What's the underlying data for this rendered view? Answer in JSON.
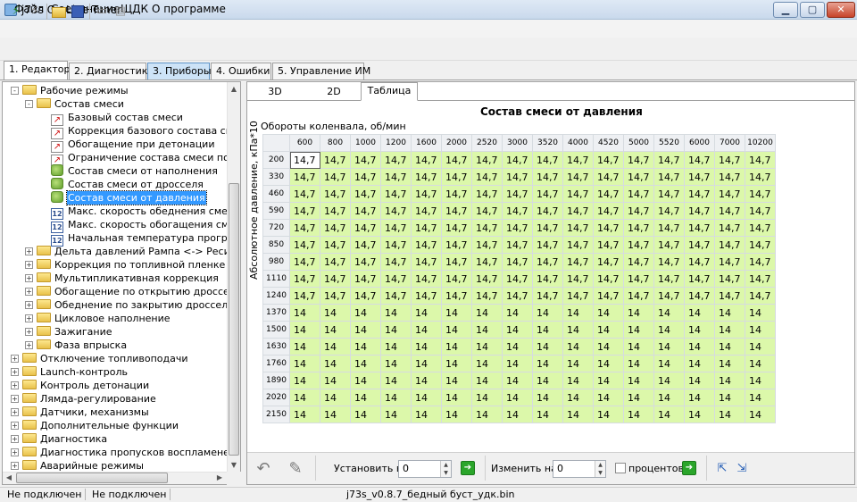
{
  "window": {
    "title": "j73s On-Line Tuner",
    "minimize": "▁",
    "maximize": "▢",
    "close": "✕"
  },
  "menu": [
    "Файл",
    "Соединение",
    "ЩДК",
    "О программе"
  ],
  "toolbar": {
    "icons": [
      "connect-icon",
      "disconnect-icon",
      "open-folder-icon",
      "save-icon",
      "chip-read-icon",
      "chip-write-icon"
    ]
  },
  "main_tabs": [
    "1. Редактор",
    "2. Диагностика",
    "3. Приборы",
    "4. Ошибки",
    "5. Управление ИМ"
  ],
  "tree": [
    {
      "label": "Рабочие режимы",
      "icon": "folder"
    },
    {
      "label": "Состав смеси",
      "icon": "folder"
    },
    {
      "label": "Базовый состав смеси",
      "icon": "chart"
    },
    {
      "label": "Коррекция базового состава сме",
      "icon": "chart"
    },
    {
      "label": "Обогащение при детонации",
      "icon": "chart"
    },
    {
      "label": "Ограничение состава смеси по т",
      "icon": "chart"
    },
    {
      "label": "Состав смеси от наполнения",
      "icon": "leaf"
    },
    {
      "label": "Состав смеси от дросселя",
      "icon": "leaf"
    },
    {
      "label": "Состав смеси от давления",
      "icon": "leaf"
    },
    {
      "label": "Макс. скорость обеднения смеси",
      "icon": "num"
    },
    {
      "label": "Макс. скорость обогащения смес",
      "icon": "num"
    },
    {
      "label": "Начальная температура прогрето",
      "icon": "num"
    },
    {
      "label": "Дельта давлений Рампа <-> Ресивер",
      "icon": "folder"
    },
    {
      "label": "Коррекция по топливной пленке",
      "icon": "folder"
    },
    {
      "label": "Мультипликативная коррекция",
      "icon": "folder"
    },
    {
      "label": "Обогащение по открытию дросселя",
      "icon": "folder"
    },
    {
      "label": "Обеднение по закрытию дросселя",
      "icon": "folder"
    },
    {
      "label": "Цикловое наполнение",
      "icon": "folder"
    },
    {
      "label": "Зажигание",
      "icon": "folder"
    },
    {
      "label": "Фаза впрыска",
      "icon": "folder"
    },
    {
      "label": "Отключение топливоподачи",
      "icon": "folder"
    },
    {
      "label": "Launch-контроль",
      "icon": "folder"
    },
    {
      "label": "Контроль детонации",
      "icon": "folder"
    },
    {
      "label": "Лямда-регулирование",
      "icon": "folder"
    },
    {
      "label": "Датчики, механизмы",
      "icon": "folder"
    },
    {
      "label": "Дополнительные функции",
      "icon": "folder"
    },
    {
      "label": "Диагностика",
      "icon": "folder"
    },
    {
      "label": "Диагностика пропусков воспламенения",
      "icon": "folder"
    },
    {
      "label": "Аварийные режимы",
      "icon": "folder"
    }
  ],
  "view_tabs": [
    "3D",
    "2D",
    "Таблица"
  ],
  "table": {
    "title": "Состав смеси от давления",
    "x_title": "Обороты коленвала, об/мин",
    "y_title": "Абсолютное давление, кПа*10",
    "columns": [
      "600",
      "800",
      "1000",
      "1200",
      "1600",
      "2000",
      "2520",
      "3000",
      "3520",
      "4000",
      "4520",
      "5000",
      "5520",
      "6000",
      "7000",
      "10200"
    ],
    "rows": [
      {
        "h": "200",
        "v": "14,7"
      },
      {
        "h": "330",
        "v": "14,7"
      },
      {
        "h": "460",
        "v": "14,7"
      },
      {
        "h": "590",
        "v": "14,7"
      },
      {
        "h": "720",
        "v": "14,7"
      },
      {
        "h": "850",
        "v": "14,7"
      },
      {
        "h": "980",
        "v": "14,7"
      },
      {
        "h": "1110",
        "v": "14,7"
      },
      {
        "h": "1240",
        "v": "14,7"
      },
      {
        "h": "1370",
        "v": "14"
      },
      {
        "h": "1500",
        "v": "14"
      },
      {
        "h": "1630",
        "v": "14"
      },
      {
        "h": "1760",
        "v": "14"
      },
      {
        "h": "1890",
        "v": "14"
      },
      {
        "h": "2020",
        "v": "14"
      },
      {
        "h": "2150",
        "v": "14"
      }
    ]
  },
  "bottom": {
    "set_label": "Установить в",
    "set_value": "0",
    "change_label": "Изменить на",
    "change_value": "0",
    "percent_label": "процентов"
  },
  "status": {
    "left1": "Не подключен",
    "left2": "Не подключен",
    "file": "j73s_v0.8.7_бедный буст_удк.bin"
  }
}
